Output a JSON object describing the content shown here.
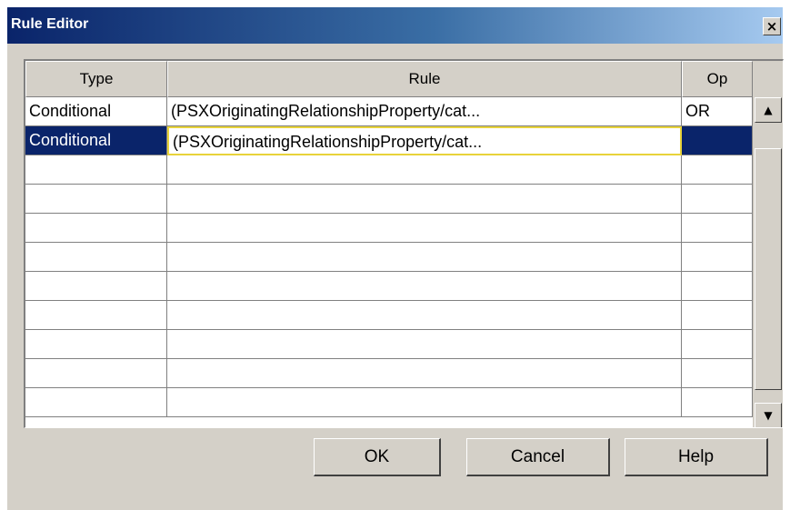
{
  "window": {
    "title": "Rule Editor",
    "close_glyph": "×",
    "close_icon": "close-icon"
  },
  "table": {
    "columns": [
      "Type",
      "Rule",
      "Op"
    ],
    "rows": [
      {
        "type": "Conditional",
        "rule": "(PSXOriginatingRelationshipProperty/cat...",
        "op": "OR"
      },
      {
        "type": "Conditional",
        "rule": "(PSXOriginatingRelationshipProperty/cat...",
        "op": ""
      }
    ],
    "empty_rows": 9,
    "selected_row": 1
  },
  "scrollbar": {
    "up_glyph": "▲",
    "down_glyph": "▼",
    "up_icon": "scroll-up-icon",
    "down_icon": "scroll-down-icon"
  },
  "buttons": {
    "ok": "OK",
    "cancel": "Cancel",
    "help": "Help"
  },
  "colors": {
    "title_gradient_start": "#0a246a",
    "title_gradient_end": "#a6caf0",
    "selection": "#0a246a",
    "dialog_bg": "#d4d0c8",
    "edit_border": "#e8d33a"
  }
}
